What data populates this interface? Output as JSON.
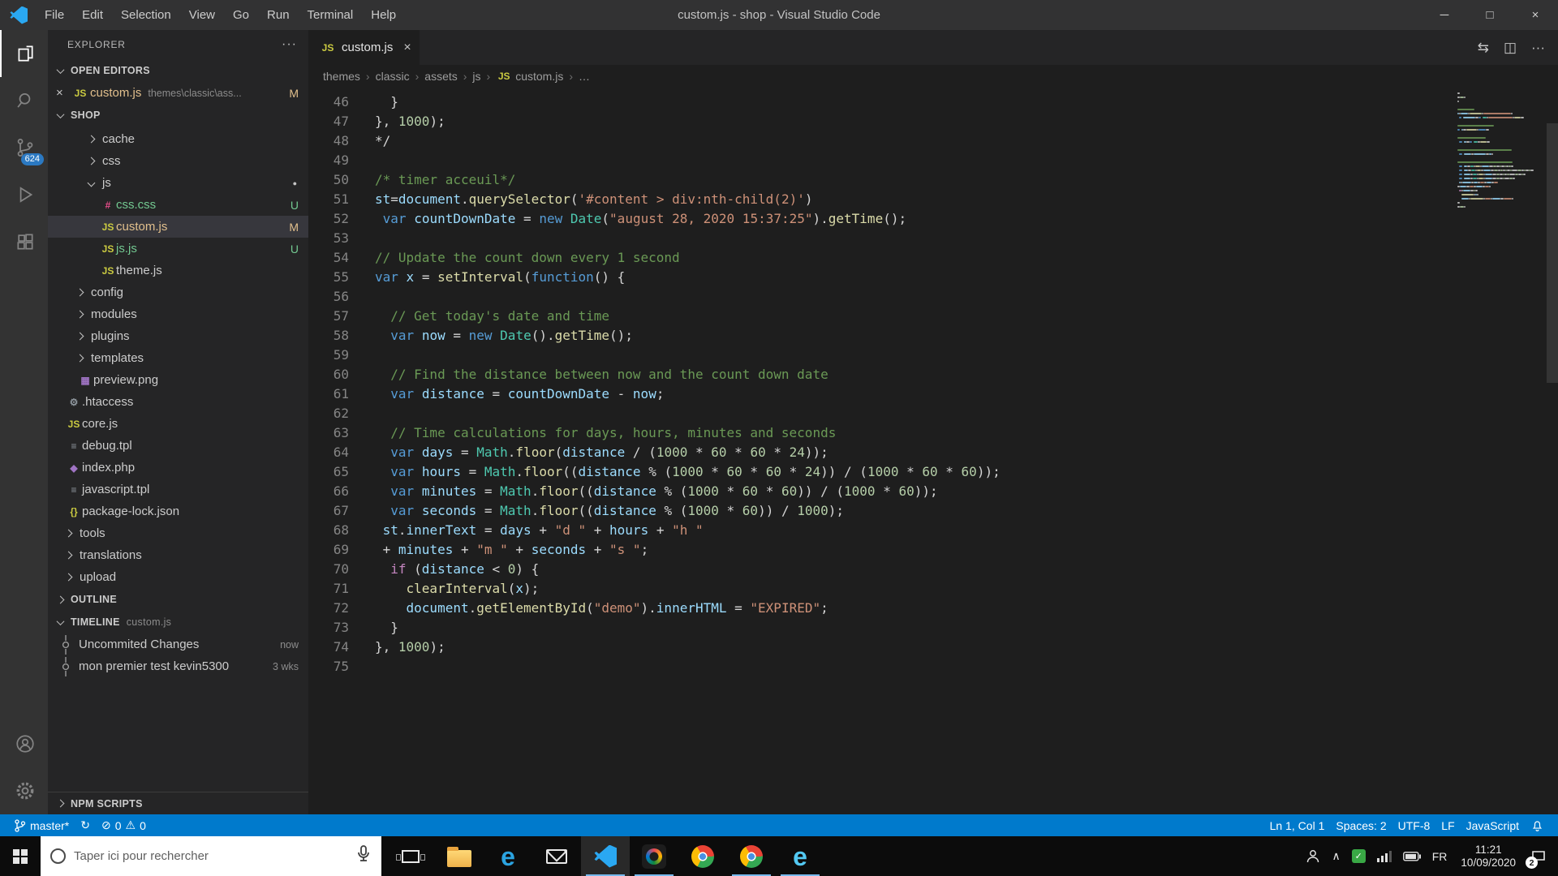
{
  "window": {
    "title": "custom.js - shop - Visual Studio Code",
    "menus": [
      "File",
      "Edit",
      "Selection",
      "View",
      "Go",
      "Run",
      "Terminal",
      "Help"
    ],
    "controls": {
      "min": "─",
      "max": "□",
      "close": "×"
    }
  },
  "icons": {
    "close": "×",
    "breadcrumb_sep": "›",
    "dot": "●"
  },
  "theme": {
    "accent": "#007acc",
    "token_colors": {
      "p": "#d4d4d4",
      "k": "#569cd6",
      "c": "#6a9955",
      "s": "#ce9178",
      "n": "#b5cea8",
      "v": "#9cdcfe",
      "f": "#dcdcaa",
      "t": "#4ec9b0",
      "x": "#c586c0"
    }
  },
  "icon_map": {
    "js": {
      "glyph": "JS",
      "color": "#cbcb41"
    },
    "css": {
      "glyph": "#",
      "color": "#e64d8a"
    },
    "image": {
      "glyph": "▦",
      "color": "#a074c4"
    },
    "gear": {
      "glyph": "⚙",
      "color": "#8f979e"
    },
    "file": {
      "glyph": "≡",
      "color": "#8f979e"
    },
    "php": {
      "glyph": "◆",
      "color": "#a074c4"
    },
    "json": {
      "glyph": "{}",
      "color": "#cbcb41"
    }
  },
  "activity_bar": {
    "scm_badge": "624"
  },
  "sidebar": {
    "title": "EXPLORER",
    "more_icon": "···",
    "sections": {
      "open_editors": {
        "label": "OPEN EDITORS",
        "items": [
          {
            "label": "custom.js",
            "path": "themes\\classic\\ass...",
            "badge": "M"
          }
        ]
      },
      "folder": {
        "label": "SHOP",
        "items": [
          {
            "label": "cache",
            "type": "folder",
            "depth": 3
          },
          {
            "label": "css",
            "type": "folder",
            "depth": 3
          },
          {
            "label": "js",
            "type": "folder",
            "depth": 3,
            "expanded": true,
            "dot": true
          },
          {
            "label": "css.css",
            "type": "css",
            "depth": 4,
            "badge": "U",
            "dec": "added"
          },
          {
            "label": "custom.js",
            "type": "js",
            "depth": 4,
            "badge": "M",
            "dec": "modified",
            "selected": true
          },
          {
            "label": "js.js",
            "type": "js",
            "depth": 4,
            "badge": "U",
            "dec": "added"
          },
          {
            "label": "theme.js",
            "type": "js",
            "depth": 4
          },
          {
            "label": "config",
            "type": "folder",
            "depth": 2
          },
          {
            "label": "modules",
            "type": "folder",
            "depth": 2
          },
          {
            "label": "plugins",
            "type": "folder",
            "depth": 2
          },
          {
            "label": "templates",
            "type": "folder",
            "depth": 2
          },
          {
            "label": "preview.png",
            "type": "image",
            "depth": 2
          },
          {
            "label": ".htaccess",
            "type": "gear",
            "depth": 1
          },
          {
            "label": "core.js",
            "type": "js",
            "depth": 1
          },
          {
            "label": "debug.tpl",
            "type": "file",
            "depth": 1
          },
          {
            "label": "index.php",
            "type": "php",
            "depth": 1
          },
          {
            "label": "javascript.tpl",
            "type": "file",
            "depth": 1
          },
          {
            "label": "package-lock.json",
            "type": "json",
            "depth": 1
          },
          {
            "label": "tools",
            "type": "folder",
            "depth": 1
          },
          {
            "label": "translations",
            "type": "folder",
            "depth": 1
          },
          {
            "label": "upload",
            "type": "folder",
            "depth": 1
          }
        ]
      },
      "outline": {
        "label": "OUTLINE"
      },
      "timeline": {
        "label": "TIMELINE",
        "context": "custom.js",
        "items": [
          {
            "label": "Uncommited Changes",
            "time": "now"
          },
          {
            "label": "mon premier test kevin5300",
            "time": "3 wks"
          }
        ]
      },
      "npm": {
        "label": "NPM SCRIPTS"
      }
    }
  },
  "editor": {
    "tab": {
      "label": "custom.js"
    },
    "actions": [
      {
        "name": "open-changes-icon",
        "glyph": "⇆"
      },
      {
        "name": "split-editor-icon",
        "glyph": "◫"
      },
      {
        "name": "more-actions-icon",
        "glyph": "···"
      }
    ],
    "breadcrumbs": [
      {
        "label": "themes"
      },
      {
        "label": "classic"
      },
      {
        "label": "assets"
      },
      {
        "label": "js"
      },
      {
        "label": "custom.js",
        "icon": "js"
      },
      {
        "label": "…"
      }
    ],
    "code": [
      {
        "n": 46,
        "t": [
          [
            "p",
            "  }"
          ]
        ]
      },
      {
        "n": 47,
        "t": [
          [
            "p",
            "}, "
          ],
          [
            "n",
            "1000"
          ],
          [
            "p",
            ");"
          ]
        ]
      },
      {
        "n": 48,
        "t": [
          [
            "p",
            "*/"
          ]
        ]
      },
      {
        "n": 49,
        "t": []
      },
      {
        "n": 50,
        "t": [
          [
            "c",
            "/* timer acceuil*/"
          ]
        ]
      },
      {
        "n": 51,
        "t": [
          [
            "v",
            "st"
          ],
          [
            "p",
            "="
          ],
          [
            "v",
            "document"
          ],
          [
            "p",
            "."
          ],
          [
            "f",
            "querySelector"
          ],
          [
            "p",
            "("
          ],
          [
            "s",
            "'#content > div:nth-child(2)'"
          ],
          [
            "p",
            ")"
          ]
        ]
      },
      {
        "n": 52,
        "t": [
          [
            "p",
            " "
          ],
          [
            "k",
            "var"
          ],
          [
            "p",
            " "
          ],
          [
            "v",
            "countDownDate"
          ],
          [
            "p",
            " = "
          ],
          [
            "k",
            "new"
          ],
          [
            "p",
            " "
          ],
          [
            "t",
            "Date"
          ],
          [
            "p",
            "("
          ],
          [
            "s",
            "\"august 28, 2020 15:37:25\""
          ],
          [
            "p",
            ")."
          ],
          [
            "f",
            "getTime"
          ],
          [
            "p",
            "();"
          ]
        ]
      },
      {
        "n": 53,
        "t": []
      },
      {
        "n": 54,
        "t": [
          [
            "c",
            "// Update the count down every 1 second"
          ]
        ]
      },
      {
        "n": 55,
        "t": [
          [
            "k",
            "var"
          ],
          [
            "p",
            " "
          ],
          [
            "v",
            "x"
          ],
          [
            "p",
            " = "
          ],
          [
            "f",
            "setInterval"
          ],
          [
            "p",
            "("
          ],
          [
            "k",
            "function"
          ],
          [
            "p",
            "() {"
          ]
        ]
      },
      {
        "n": 56,
        "t": []
      },
      {
        "n": 57,
        "t": [
          [
            "c",
            "  // Get today's date and time"
          ]
        ]
      },
      {
        "n": 58,
        "t": [
          [
            "p",
            "  "
          ],
          [
            "k",
            "var"
          ],
          [
            "p",
            " "
          ],
          [
            "v",
            "now"
          ],
          [
            "p",
            " = "
          ],
          [
            "k",
            "new"
          ],
          [
            "p",
            " "
          ],
          [
            "t",
            "Date"
          ],
          [
            "p",
            "()."
          ],
          [
            "f",
            "getTime"
          ],
          [
            "p",
            "();"
          ]
        ]
      },
      {
        "n": 59,
        "t": []
      },
      {
        "n": 60,
        "t": [
          [
            "c",
            "  // Find the distance between now and the count down date"
          ]
        ]
      },
      {
        "n": 61,
        "t": [
          [
            "p",
            "  "
          ],
          [
            "k",
            "var"
          ],
          [
            "p",
            " "
          ],
          [
            "v",
            "distance"
          ],
          [
            "p",
            " = "
          ],
          [
            "v",
            "countDownDate"
          ],
          [
            "p",
            " - "
          ],
          [
            "v",
            "now"
          ],
          [
            "p",
            ";"
          ]
        ]
      },
      {
        "n": 62,
        "t": []
      },
      {
        "n": 63,
        "t": [
          [
            "c",
            "  // Time calculations for days, hours, minutes and seconds"
          ]
        ]
      },
      {
        "n": 64,
        "t": [
          [
            "p",
            "  "
          ],
          [
            "k",
            "var"
          ],
          [
            "p",
            " "
          ],
          [
            "v",
            "days"
          ],
          [
            "p",
            " = "
          ],
          [
            "t",
            "Math"
          ],
          [
            "p",
            "."
          ],
          [
            "f",
            "floor"
          ],
          [
            "p",
            "("
          ],
          [
            "v",
            "distance"
          ],
          [
            "p",
            " / ("
          ],
          [
            "n",
            "1000"
          ],
          [
            "p",
            " * "
          ],
          [
            "n",
            "60"
          ],
          [
            "p",
            " * "
          ],
          [
            "n",
            "60"
          ],
          [
            "p",
            " * "
          ],
          [
            "n",
            "24"
          ],
          [
            "p",
            "));"
          ]
        ]
      },
      {
        "n": 65,
        "t": [
          [
            "p",
            "  "
          ],
          [
            "k",
            "var"
          ],
          [
            "p",
            " "
          ],
          [
            "v",
            "hours"
          ],
          [
            "p",
            " = "
          ],
          [
            "t",
            "Math"
          ],
          [
            "p",
            "."
          ],
          [
            "f",
            "floor"
          ],
          [
            "p",
            "(("
          ],
          [
            "v",
            "distance"
          ],
          [
            "p",
            " % ("
          ],
          [
            "n",
            "1000"
          ],
          [
            "p",
            " * "
          ],
          [
            "n",
            "60"
          ],
          [
            "p",
            " * "
          ],
          [
            "n",
            "60"
          ],
          [
            "p",
            " * "
          ],
          [
            "n",
            "24"
          ],
          [
            "p",
            ")) / ("
          ],
          [
            "n",
            "1000"
          ],
          [
            "p",
            " * "
          ],
          [
            "n",
            "60"
          ],
          [
            "p",
            " * "
          ],
          [
            "n",
            "60"
          ],
          [
            "p",
            "));"
          ]
        ]
      },
      {
        "n": 66,
        "t": [
          [
            "p",
            "  "
          ],
          [
            "k",
            "var"
          ],
          [
            "p",
            " "
          ],
          [
            "v",
            "minutes"
          ],
          [
            "p",
            " = "
          ],
          [
            "t",
            "Math"
          ],
          [
            "p",
            "."
          ],
          [
            "f",
            "floor"
          ],
          [
            "p",
            "(("
          ],
          [
            "v",
            "distance"
          ],
          [
            "p",
            " % ("
          ],
          [
            "n",
            "1000"
          ],
          [
            "p",
            " * "
          ],
          [
            "n",
            "60"
          ],
          [
            "p",
            " * "
          ],
          [
            "n",
            "60"
          ],
          [
            "p",
            ")) / ("
          ],
          [
            "n",
            "1000"
          ],
          [
            "p",
            " * "
          ],
          [
            "n",
            "60"
          ],
          [
            "p",
            "));"
          ]
        ]
      },
      {
        "n": 67,
        "t": [
          [
            "p",
            "  "
          ],
          [
            "k",
            "var"
          ],
          [
            "p",
            " "
          ],
          [
            "v",
            "seconds"
          ],
          [
            "p",
            " = "
          ],
          [
            "t",
            "Math"
          ],
          [
            "p",
            "."
          ],
          [
            "f",
            "floor"
          ],
          [
            "p",
            "(("
          ],
          [
            "v",
            "distance"
          ],
          [
            "p",
            " % ("
          ],
          [
            "n",
            "1000"
          ],
          [
            "p",
            " * "
          ],
          [
            "n",
            "60"
          ],
          [
            "p",
            ")) / "
          ],
          [
            "n",
            "1000"
          ],
          [
            "p",
            ");"
          ]
        ]
      },
      {
        "n": 68,
        "t": [
          [
            "p",
            " "
          ],
          [
            "v",
            "st"
          ],
          [
            "p",
            "."
          ],
          [
            "v",
            "innerText"
          ],
          [
            "p",
            " = "
          ],
          [
            "v",
            "days"
          ],
          [
            "p",
            " + "
          ],
          [
            "s",
            "\"d \""
          ],
          [
            "p",
            " + "
          ],
          [
            "v",
            "hours"
          ],
          [
            "p",
            " + "
          ],
          [
            "s",
            "\"h \""
          ]
        ]
      },
      {
        "n": 69,
        "t": [
          [
            "p",
            " + "
          ],
          [
            "v",
            "minutes"
          ],
          [
            "p",
            " + "
          ],
          [
            "s",
            "\"m \""
          ],
          [
            "p",
            " + "
          ],
          [
            "v",
            "seconds"
          ],
          [
            "p",
            " + "
          ],
          [
            "s",
            "\"s \""
          ],
          [
            "p",
            ";"
          ]
        ]
      },
      {
        "n": 70,
        "t": [
          [
            "p",
            "  "
          ],
          [
            "x",
            "if"
          ],
          [
            "p",
            " ("
          ],
          [
            "v",
            "distance"
          ],
          [
            "p",
            " < "
          ],
          [
            "n",
            "0"
          ],
          [
            "p",
            ") {"
          ]
        ]
      },
      {
        "n": 71,
        "t": [
          [
            "p",
            "    "
          ],
          [
            "f",
            "clearInterval"
          ],
          [
            "p",
            "("
          ],
          [
            "v",
            "x"
          ],
          [
            "p",
            ");"
          ]
        ]
      },
      {
        "n": 72,
        "t": [
          [
            "p",
            "    "
          ],
          [
            "v",
            "document"
          ],
          [
            "p",
            "."
          ],
          [
            "f",
            "getElementById"
          ],
          [
            "p",
            "("
          ],
          [
            "s",
            "\"demo\""
          ],
          [
            "p",
            ")."
          ],
          [
            "v",
            "innerHTML"
          ],
          [
            "p",
            " = "
          ],
          [
            "s",
            "\"EXPIRED\""
          ],
          [
            "p",
            ";"
          ]
        ]
      },
      {
        "n": 73,
        "t": [
          [
            "p",
            "  }"
          ]
        ]
      },
      {
        "n": 74,
        "t": [
          [
            "p",
            "}, "
          ],
          [
            "n",
            "1000"
          ],
          [
            "p",
            ");"
          ]
        ]
      },
      {
        "n": 75,
        "t": []
      }
    ]
  },
  "status_bar": {
    "branch": "master*",
    "sync_icon": "↻",
    "error_icon": "⊘",
    "errors": "0",
    "warning_icon": "⚠",
    "warnings": "0",
    "line_col": "Ln 1, Col 1",
    "indent": "Spaces: 2",
    "encoding": "UTF-8",
    "eol": "LF",
    "language": "JavaScript"
  },
  "taskbar": {
    "search_placeholder": "Taper ici pour rechercher",
    "expand_icon": "∧",
    "language": "FR",
    "time": "11:21",
    "date": "10/09/2020",
    "notification_count": "2",
    "apps": [
      {
        "name": "task-view-button",
        "kind": "taskview"
      },
      {
        "name": "file-explorer-button",
        "kind": "folder"
      },
      {
        "name": "edge-button",
        "kind": "edge"
      },
      {
        "name": "mail-button",
        "kind": "mail"
      },
      {
        "name": "vscode-button",
        "kind": "vscode",
        "active": true
      },
      {
        "name": "feedback-hub-button",
        "kind": "hub",
        "running": true
      },
      {
        "name": "chrome-button",
        "kind": "chrome"
      },
      {
        "name": "chrome-2-button",
        "kind": "chrome",
        "running": true
      },
      {
        "name": "ie-button",
        "kind": "ie",
        "running": true
      }
    ]
  }
}
